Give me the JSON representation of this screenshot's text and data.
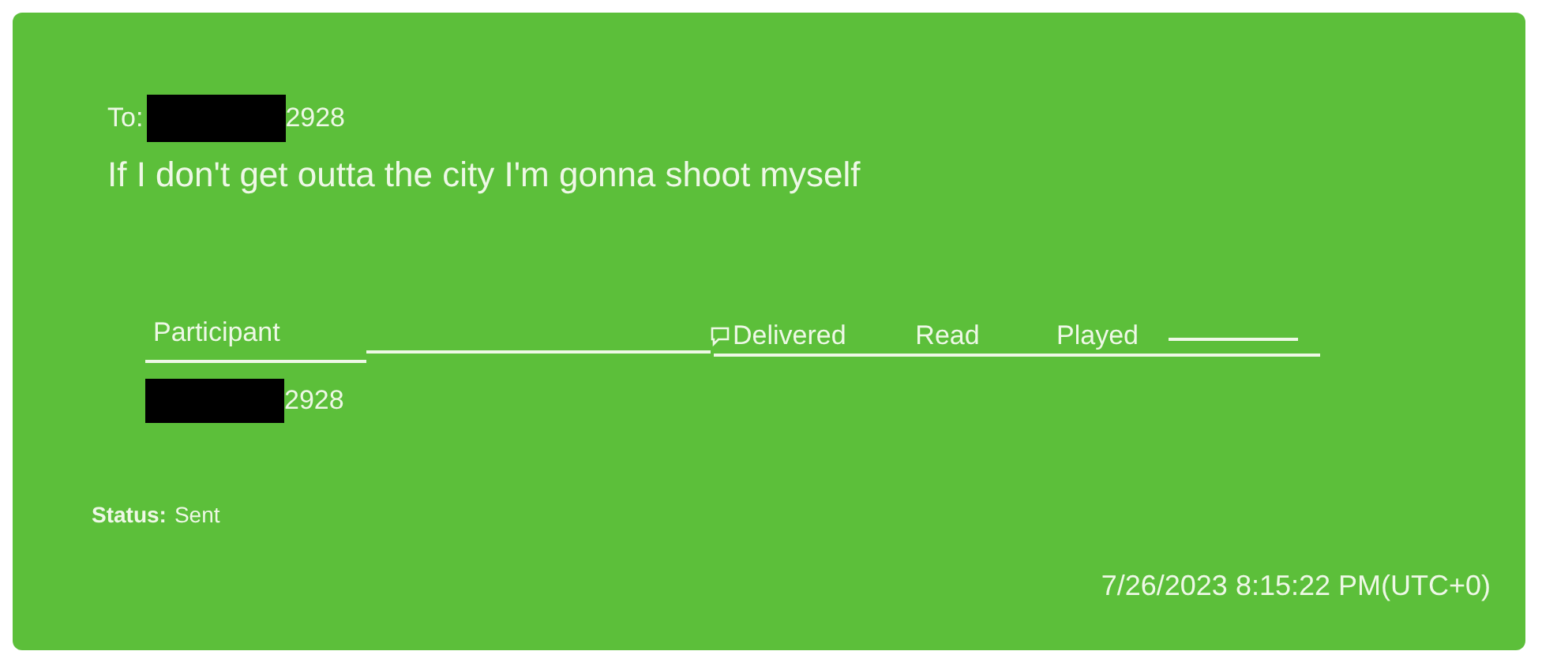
{
  "message": {
    "to_label": "To:",
    "to_number_suffix": "2928",
    "body": "If I don't get outta the city I'm gonna shoot myself",
    "table": {
      "columns": [
        "Participant",
        "Delivered",
        "Read",
        "Played"
      ],
      "rows": [
        {
          "participant_suffix": "2928"
        }
      ]
    },
    "status_label": "Status:",
    "status_value": "Sent",
    "timestamp": "7/26/2023 8:15:22 PM(UTC+0)"
  }
}
